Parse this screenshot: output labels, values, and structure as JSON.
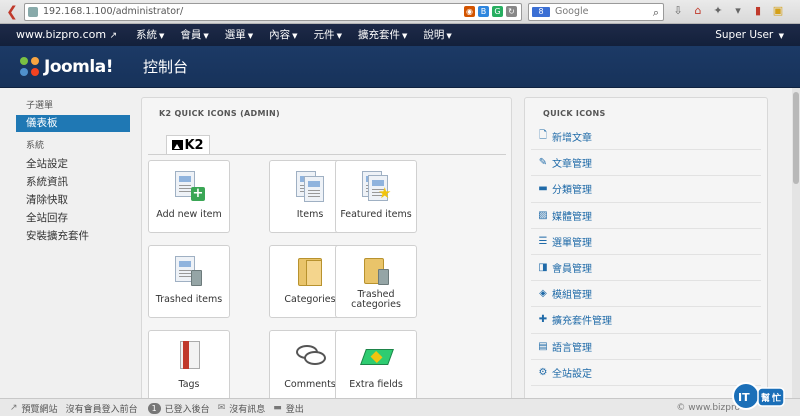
{
  "browser": {
    "url": "192.168.1.100/administrator/",
    "search_placeholder": "Google",
    "search_engine": "8"
  },
  "navbar": {
    "brand": "www.bizpro.com",
    "menu": [
      {
        "label": "系統"
      },
      {
        "label": "會員"
      },
      {
        "label": "選單"
      },
      {
        "label": "內容"
      },
      {
        "label": "元件"
      },
      {
        "label": "擴充套件"
      },
      {
        "label": "說明"
      }
    ],
    "user": "Super User"
  },
  "header": {
    "logo_text": "Joomla!",
    "page_title": "控制台"
  },
  "sidebar": {
    "submenu_heading": "子選單",
    "active_item": "儀表板",
    "system_heading": "系統",
    "items": [
      "全站設定",
      "系統資訊",
      "清除快取",
      "全站回存",
      "安裝擴充套件"
    ]
  },
  "k2_panel": {
    "title": "K2 QUICK ICONS (ADMIN)",
    "tab_label": "K2",
    "tiles": [
      {
        "label": "Add new item",
        "icon": "add-document-icon"
      },
      {
        "label": "Items",
        "icon": "documents-icon"
      },
      {
        "label": "Featured items",
        "icon": "featured-star-icon"
      },
      {
        "label": "Trashed items",
        "icon": "trash-documents-icon"
      },
      {
        "label": "Categories",
        "icon": "folder-icon"
      },
      {
        "label": "Trashed categories",
        "icon": "trash-folder-icon"
      },
      {
        "label": "Tags",
        "icon": "tag-icon"
      },
      {
        "label": "Comments",
        "icon": "comments-icon"
      },
      {
        "label": "Extra fields",
        "icon": "extra-fields-icon"
      }
    ]
  },
  "quick_icons": {
    "title": "QUICK ICONS",
    "items": [
      {
        "label": "新增文章",
        "icon": "new-file-icon"
      },
      {
        "label": "文章管理",
        "icon": "pencil-icon"
      },
      {
        "label": "分類管理",
        "icon": "folder-icon"
      },
      {
        "label": "媒體管理",
        "icon": "image-icon"
      },
      {
        "label": "選單管理",
        "icon": "list-icon"
      },
      {
        "label": "會員管理",
        "icon": "users-icon"
      },
      {
        "label": "模組管理",
        "icon": "cube-icon"
      },
      {
        "label": "擴充套件管理",
        "icon": "puzzle-icon"
      },
      {
        "label": "語言管理",
        "icon": "comments-icon"
      },
      {
        "label": "全站設定",
        "icon": "gear-icon"
      }
    ]
  },
  "status_bar": {
    "preview": "預覽網站",
    "no_frontend": "沒有會員登入前台",
    "backend_count": "1",
    "backend_text": "已登入後台",
    "messages": "沒有訊息",
    "logout": "登出",
    "copyright": "© www.bizpro"
  },
  "colors": {
    "navbar": "#1a2744",
    "header": "#1c3a66",
    "accent": "#1f78b4",
    "link": "#1f6aa8"
  }
}
